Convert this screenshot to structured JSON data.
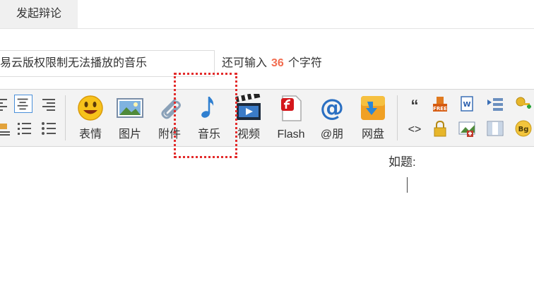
{
  "tab": {
    "label": "发起辩论"
  },
  "title_field": {
    "value": "易云版权限制无法播放的音乐"
  },
  "counter": {
    "prefix": "还可输入",
    "count": "36",
    "suffix": "个字符"
  },
  "toolbar": {
    "tools": [
      {
        "id": "emoji",
        "label": "表情",
        "icon": "smiley-icon"
      },
      {
        "id": "image",
        "label": "图片",
        "icon": "picture-icon"
      },
      {
        "id": "attach",
        "label": "附件",
        "icon": "paperclip-icon"
      },
      {
        "id": "music",
        "label": "音乐",
        "icon": "music-note-icon"
      },
      {
        "id": "video",
        "label": "视频",
        "icon": "clapperboard-icon"
      },
      {
        "id": "flash",
        "label": "Flash",
        "icon": "flash-icon"
      },
      {
        "id": "at",
        "label": "@朋",
        "icon": "at-icon"
      },
      {
        "id": "netdisk",
        "label": "网盘",
        "icon": "netdisk-icon"
      }
    ],
    "right_icons": {
      "quote": "“",
      "code": "<>",
      "free": "FREE",
      "bg": "Bg"
    }
  },
  "colors": {
    "highlight": "#e32b2b",
    "counter_number": "#f26c4f",
    "toolbar_bg": "#f3f3f3"
  },
  "editor": {
    "text": "如题:"
  }
}
